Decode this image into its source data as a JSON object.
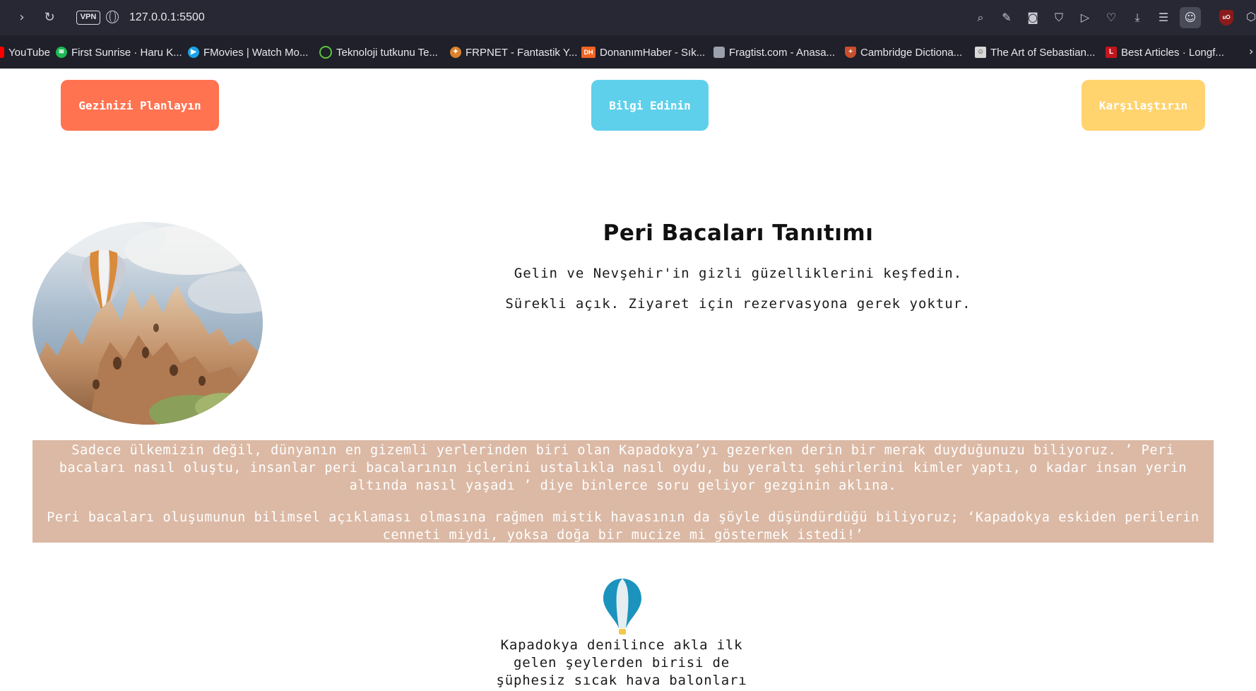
{
  "browser": {
    "url": "127.0.0.1:5500",
    "vpn_label": "VPN",
    "bookmarks": [
      {
        "label": "YouTube",
        "icon": "youtube-icon",
        "color": "#ff0000"
      },
      {
        "label": "First Sunrise · Haru K...",
        "icon": "spotify-icon",
        "color": "#1db954"
      },
      {
        "label": "FMovies | Watch Mo...",
        "icon": "play-icon",
        "color": "#1aa3e8"
      },
      {
        "label": "Teknoloji tutkunu Te...",
        "icon": "power-icon",
        "color": "#5cc53b"
      },
      {
        "label": "FRPNET - Fantastik Y...",
        "icon": "frpnet-icon",
        "color": "#d9822b"
      },
      {
        "label": "DonanımHaber - Sık...",
        "icon": "dh-icon",
        "color": "#f26522"
      },
      {
        "label": "Fragtist.com - Anasa...",
        "icon": "fragtist-icon",
        "color": "#9aa0ad"
      },
      {
        "label": "Cambridge Dictiona...",
        "icon": "cambridge-icon",
        "color": "#c94f2b"
      },
      {
        "label": "The Art of Sebastian...",
        "icon": "portrait-icon",
        "color": "#d8d8d8"
      },
      {
        "label": "Best Articles · Longf...",
        "icon": "longform-icon",
        "color": "#c4141c"
      }
    ]
  },
  "nav": {
    "plan_label": "Gezinizi Planlayın",
    "info_label": "Bilgi Edinin",
    "compare_label": "Karşılaştırın"
  },
  "hero": {
    "title": "Peri Bacaları Tanıtımı",
    "line1": "Gelin ve Nevşehir'in gizli güzelliklerini keşfedin.",
    "line2": "Sürekli açık. Ziyaret için rezervasyona gerek yoktur."
  },
  "story": {
    "paragraph1": "Sadece ülkemizin değil, dünyanın en gizemli yerlerinden biri olan Kapadokya’yı gezerken derin bir merak duyduğunuzu biliyoruz. ’ Peri bacaları nasıl oluştu, insanlar peri bacalarının içlerini ustalıkla nasıl oydu, bu yeraltı şehirlerini kimler yaptı, o kadar insan yerin altında nasıl yaşadı ’ diye binlerce soru geliyor gezginin aklına.",
    "paragraph2": "Peri bacaları oluşumunun bilimsel açıklaması olmasına rağmen mistik havasının da şöyle düşündürdüğü biliyoruz; ‘Kapadokya eskiden perilerin cenneti miydi, yoksa doğa bir mucize mi göstermek istedi!’"
  },
  "balloon_section": {
    "caption": "Kapadokya denilince akla ilk gelen şeylerden birisi de şüphesiz sıcak hava balonları"
  },
  "colors": {
    "plan": "#ff7350",
    "info": "#5fd0eb",
    "compare": "#ffd36e",
    "story_bg": "#dbb9a5"
  }
}
